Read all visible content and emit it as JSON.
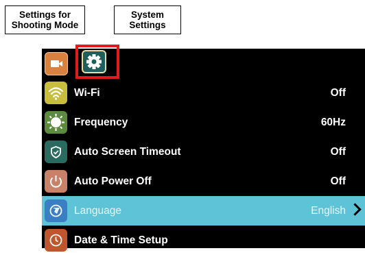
{
  "callouts": {
    "shooting_mode": "Settings for\nShooting Mode",
    "system_settings": "System\nSettings"
  },
  "tabs": [
    {
      "name": "video-camera-icon"
    },
    {
      "name": "gear-icon",
      "selected": true
    }
  ],
  "menu": [
    {
      "label": "Wi-Fi",
      "value": "Off",
      "icon": "wifi-icon",
      "color": "#c8bd3c"
    },
    {
      "label": "Frequency",
      "value": "60Hz",
      "icon": "sun-icon",
      "color": "#5b8b3c"
    },
    {
      "label": "Auto Screen Timeout",
      "value": "Off",
      "icon": "shield-icon",
      "color": "#2b6b5f"
    },
    {
      "label": "Auto Power Off",
      "value": "Off",
      "icon": "power-icon",
      "color": "#c8826a"
    },
    {
      "label": "Language",
      "value": "English",
      "icon": "globe-icon",
      "color": "#3a7fc4",
      "selected": true
    },
    {
      "label": "Date & Time Setup",
      "value": "",
      "icon": "clock-icon",
      "color": "#c0562e"
    }
  ],
  "colors": {
    "highlight": "#5ec3d6",
    "selection_box": "#e01b1b"
  }
}
